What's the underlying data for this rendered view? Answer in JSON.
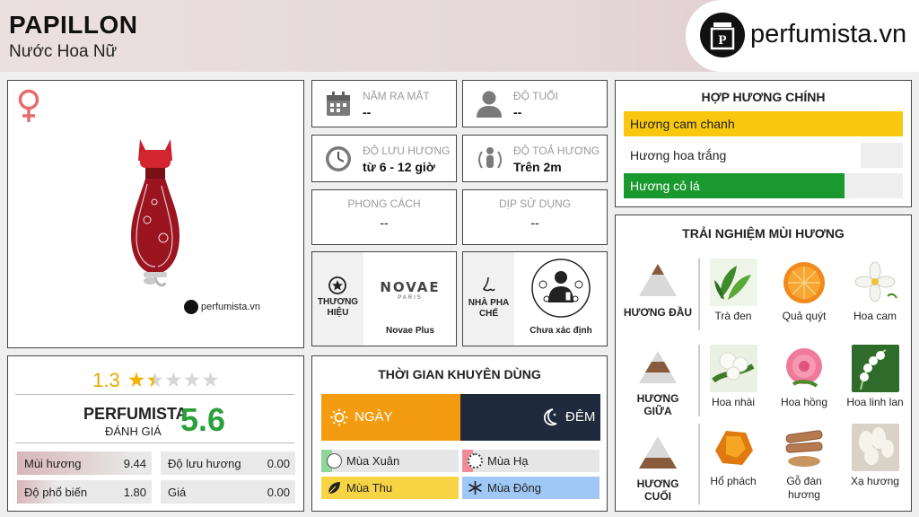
{
  "header": {
    "title": "PAPILLON",
    "subtitle": "Nước Hoa Nữ",
    "logo_text": "perfumista.vn"
  },
  "product": {
    "gender_icon": "female-symbol-icon",
    "watermark": "perfumista.vn"
  },
  "rating": {
    "value": "1.3",
    "stars": 1.3,
    "perfumista_label": "PERFUMISTA",
    "perfumista_sub": "ĐÁNH GIÁ",
    "perfumista_score": "5.6",
    "metrics": [
      {
        "label": "Mùi hương",
        "value": "9.44",
        "fraction": 0.944
      },
      {
        "label": "Độ lưu hương",
        "value": "0.00",
        "fraction": 0
      },
      {
        "label": "Độ phổ biến",
        "value": "1.80",
        "fraction": 0.18
      },
      {
        "label": "Giá",
        "value": "0.00",
        "fraction": 0
      }
    ]
  },
  "info": {
    "launch": {
      "title": "NĂM RA MẮT",
      "value": "--"
    },
    "age": {
      "title": "ĐỘ TUỔI",
      "value": "--"
    },
    "longevity": {
      "title": "ĐỘ LƯU HƯƠNG",
      "value": "từ 6 - 12 giờ"
    },
    "sillage": {
      "title": "ĐỘ TOẢ HƯƠNG",
      "value": "Trên 2m"
    },
    "style": {
      "title": "PHONG CÁCH",
      "value": "--"
    },
    "occasion": {
      "title": "DỊP SỬ DỤNG",
      "value": "--"
    },
    "brand": {
      "label": "THƯƠNG HIỆU",
      "logo_text": "NOVAE",
      "logo_sub": "PARIS",
      "name": "Novae Plus"
    },
    "perfumer": {
      "label": "NHÀ PHA CHẾ",
      "name": "Chưa xác định"
    }
  },
  "usage": {
    "title": "THỜI GIAN KHUYÊN DÙNG",
    "day": "NGÀY",
    "night": "ĐÊM",
    "seasons": [
      {
        "label": "Mùa Xuân",
        "fraction": 0.08
      },
      {
        "label": "Mùa Hạ",
        "fraction": 0.08
      },
      {
        "label": "Mùa Thu",
        "fraction": 1.0
      },
      {
        "label": "Mùa Đông",
        "fraction": 1.0
      }
    ],
    "colors": {
      "day": "#f39c12",
      "night": "#1f2a3c",
      "spring": "#8fd69a",
      "summer": "#f08c9a",
      "autumn": "#f7d443",
      "winter": "#9fc8f6"
    }
  },
  "accords": {
    "title": "HỢP HƯƠNG CHÍNH",
    "items": [
      {
        "label": "Hương cam chanh",
        "fraction": 1.0,
        "color": "#f9c80e"
      },
      {
        "label": "Hương hoa trắng",
        "fraction": 0.85,
        "color": "#ffffff"
      },
      {
        "label": "Hương cỏ lá",
        "fraction": 0.79,
        "color": "#1a9a2e"
      }
    ]
  },
  "notes": {
    "title": "TRẢI NGHIỆM MÙI HƯƠNG",
    "tiers": [
      {
        "label": "HƯƠNG ĐẦU",
        "notes": [
          "Trà đen",
          "Quả quýt",
          "Hoa cam"
        ]
      },
      {
        "label": "HƯƠNG GIỮA",
        "notes": [
          "Hoa nhài",
          "Hoa hồng",
          "Hoa linh lan"
        ]
      },
      {
        "label": "HƯƠNG CUỐI",
        "notes": [
          "Hổ phách",
          "Gỗ đàn hương",
          "Xạ hương"
        ]
      }
    ]
  }
}
